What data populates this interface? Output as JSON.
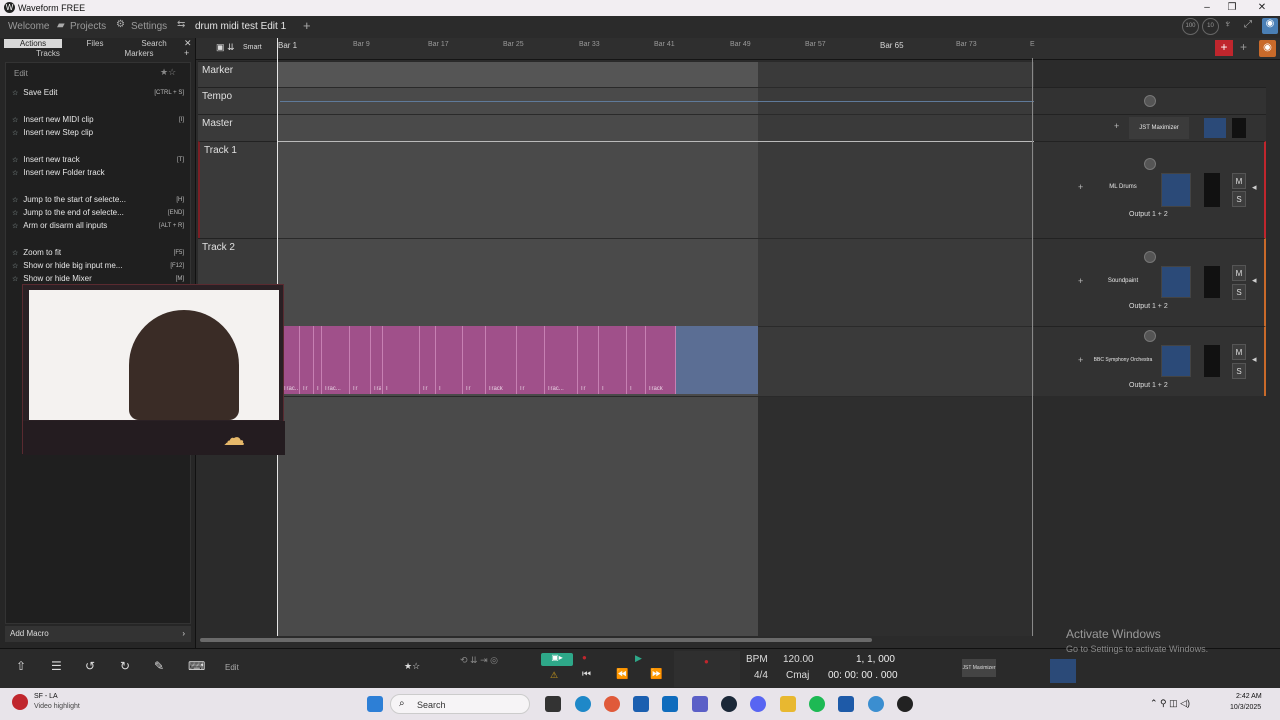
{
  "window": {
    "title": "Waveform FREE"
  },
  "tabs": [
    {
      "label": "Welcome"
    },
    {
      "label": "Projects"
    },
    {
      "label": "Settings"
    },
    {
      "label": "drum midi test Edit 1"
    }
  ],
  "left_panel": {
    "tabs": [
      "Actions",
      "Files",
      "Search",
      "Tracks",
      "Markers"
    ],
    "section": "Edit",
    "actions": [
      {
        "label": "Save Edit",
        "key": "[CTRL + S]"
      },
      {
        "label": "Insert new MIDI clip",
        "key": "[I]"
      },
      {
        "label": "Insert new Step clip",
        "key": ""
      },
      {
        "label": "Insert new track",
        "key": "[T]"
      },
      {
        "label": "Insert new Folder track",
        "key": ""
      },
      {
        "label": "Jump to the start of selecte...",
        "key": "[H]"
      },
      {
        "label": "Jump to the end of selecte...",
        "key": "[END]"
      },
      {
        "label": "Arm or disarm all inputs",
        "key": "[ALT + R]"
      },
      {
        "label": "Zoom to fit",
        "key": "[F5]"
      },
      {
        "label": "Show or hide big input me...",
        "key": "[F12]"
      },
      {
        "label": "Show or hide Mixer",
        "key": "[M]"
      }
    ],
    "add_macro": "Add Macro"
  },
  "toolbar": {
    "mode": "Smart"
  },
  "ruler": {
    "bars": [
      "Bar 1",
      "Bar 9",
      "Bar 17",
      "Bar 25",
      "Bar 33",
      "Bar 41",
      "Bar 49",
      "Bar 57",
      "Bar 65",
      "Bar 73",
      "E"
    ]
  },
  "tracks": {
    "marker": "Marker",
    "tempo": "Tempo",
    "master": "Master",
    "track1": "Track 1",
    "track2": "Track 2"
  },
  "mixer": {
    "master_plugin": "JST Maximizer",
    "t1_plugin": "ML Drums",
    "t2_plugin": "Soundpaint",
    "t3_plugin": "BBC Symphony Orchestra",
    "output": "Output 1 + 2",
    "m": "M",
    "s": "S"
  },
  "clips": [
    "Trac...",
    "Tr",
    "T",
    "Trac...",
    "Tr",
    "Track 1",
    "T",
    "Tr",
    "T",
    "Tr",
    "Track",
    "Tr",
    "Trac...",
    "Tr",
    "T",
    "T",
    "Track"
  ],
  "transport": {
    "edit_label": "Edit",
    "bpm_label": "BPM",
    "bpm": "120.00",
    "position": "1, 1, 000",
    "time_sig": "4/4",
    "key": "Cmaj",
    "time": "00: 00: 00 . 000",
    "plugin": "JST Maximizer"
  },
  "watermark": {
    "title": "Activate Windows",
    "subtitle": "Go to Settings to activate Windows."
  },
  "taskbar": {
    "notif_title": "SF - LA",
    "notif_sub": "Video highlight",
    "search": "Search",
    "time": "2:42 AM",
    "date": "10/3/2025"
  }
}
